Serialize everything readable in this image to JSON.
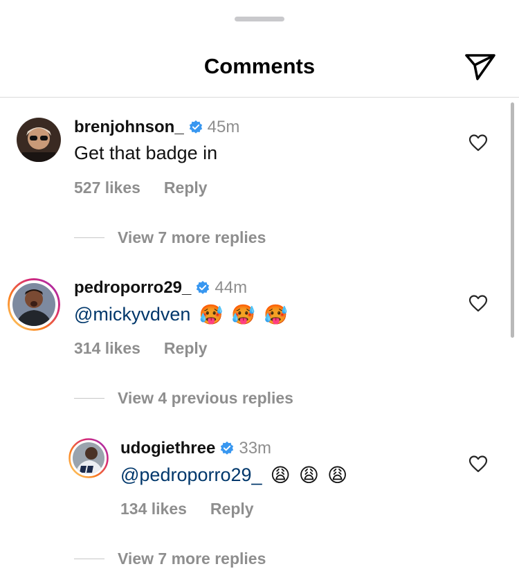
{
  "header": {
    "title": "Comments"
  },
  "comments": [
    {
      "username": "brenjohnson_",
      "time": "45m",
      "text": "Get that badge in",
      "likes": "527 likes",
      "reply_label": "Reply",
      "view_more": "View 7 more replies"
    },
    {
      "username": "pedroporro29_",
      "time": "44m",
      "mention": "@mickyvdven",
      "emojis": [
        "🥵",
        "🥵",
        "🥵"
      ],
      "likes": "314 likes",
      "reply_label": "Reply",
      "view_more": "View 4 previous replies"
    },
    {
      "username": "udogiethree",
      "time": "33m",
      "mention": "@pedroporro29_",
      "emojis": [
        "😩",
        "😩",
        "😩"
      ],
      "likes": "134 likes",
      "reply_label": "Reply",
      "view_more": "View 7 more replies"
    }
  ],
  "colors": {
    "verified": "#3897f0",
    "mention": "#00376b",
    "meta": "#8e8e8e",
    "story_ring": [
      "#feda75",
      "#fa7e1e",
      "#d62976",
      "#962fbf"
    ]
  },
  "icons": [
    "share-paper-plane-icon",
    "verified-badge-icon",
    "heart-outline-icon"
  ]
}
